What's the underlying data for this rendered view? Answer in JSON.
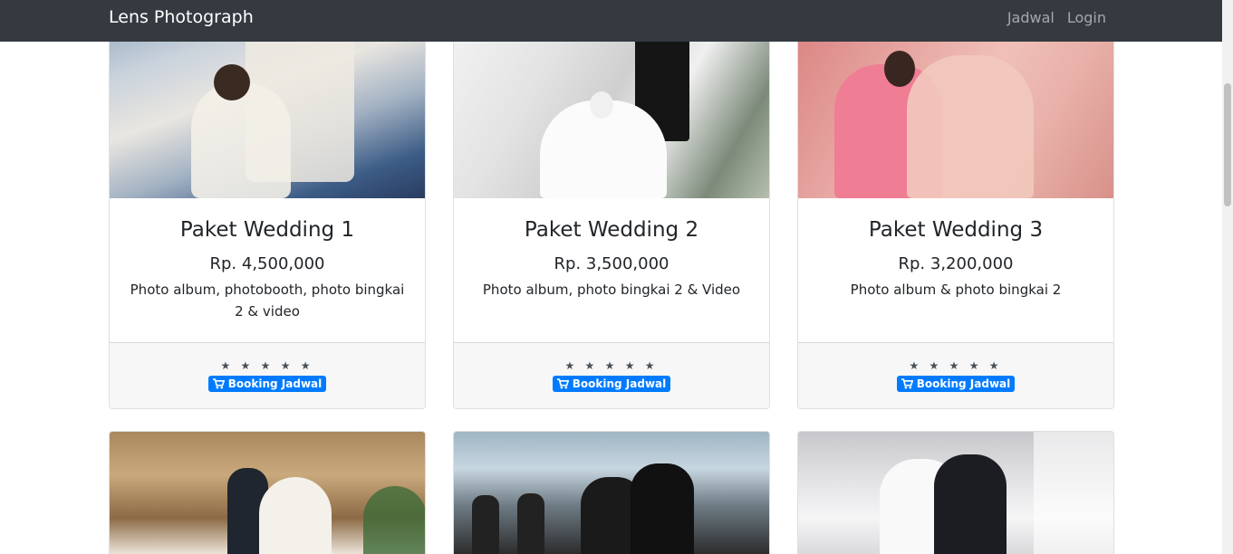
{
  "navbar": {
    "brand": "Lens Photograph",
    "links": [
      "Jadwal",
      "Login"
    ]
  },
  "packages": [
    {
      "title": "Paket Wedding 1",
      "price": "Rp. 4,500,000",
      "description": "Photo album, photobooth, photo bingkai 2 & video",
      "rating": "★ ★ ★ ★ ★",
      "button": "Booking Jadwal"
    },
    {
      "title": "Paket Wedding 2",
      "price": "Rp. 3,500,000",
      "description": "Photo album, photo bingkai 2 & Video",
      "rating": "★ ★ ★ ★ ★",
      "button": "Booking Jadwal"
    },
    {
      "title": "Paket Wedding 3",
      "price": "Rp. 3,200,000",
      "description": "Photo album & photo bingkai 2",
      "rating": "★ ★ ★ ★ ★",
      "button": "Booking Jadwal"
    }
  ],
  "icons": {
    "cart": "shopping-cart-icon",
    "star": "star-icon"
  },
  "colors": {
    "navbar_bg": "#343a40",
    "primary": "#007bff",
    "footer_bg": "#f7f7f7"
  }
}
